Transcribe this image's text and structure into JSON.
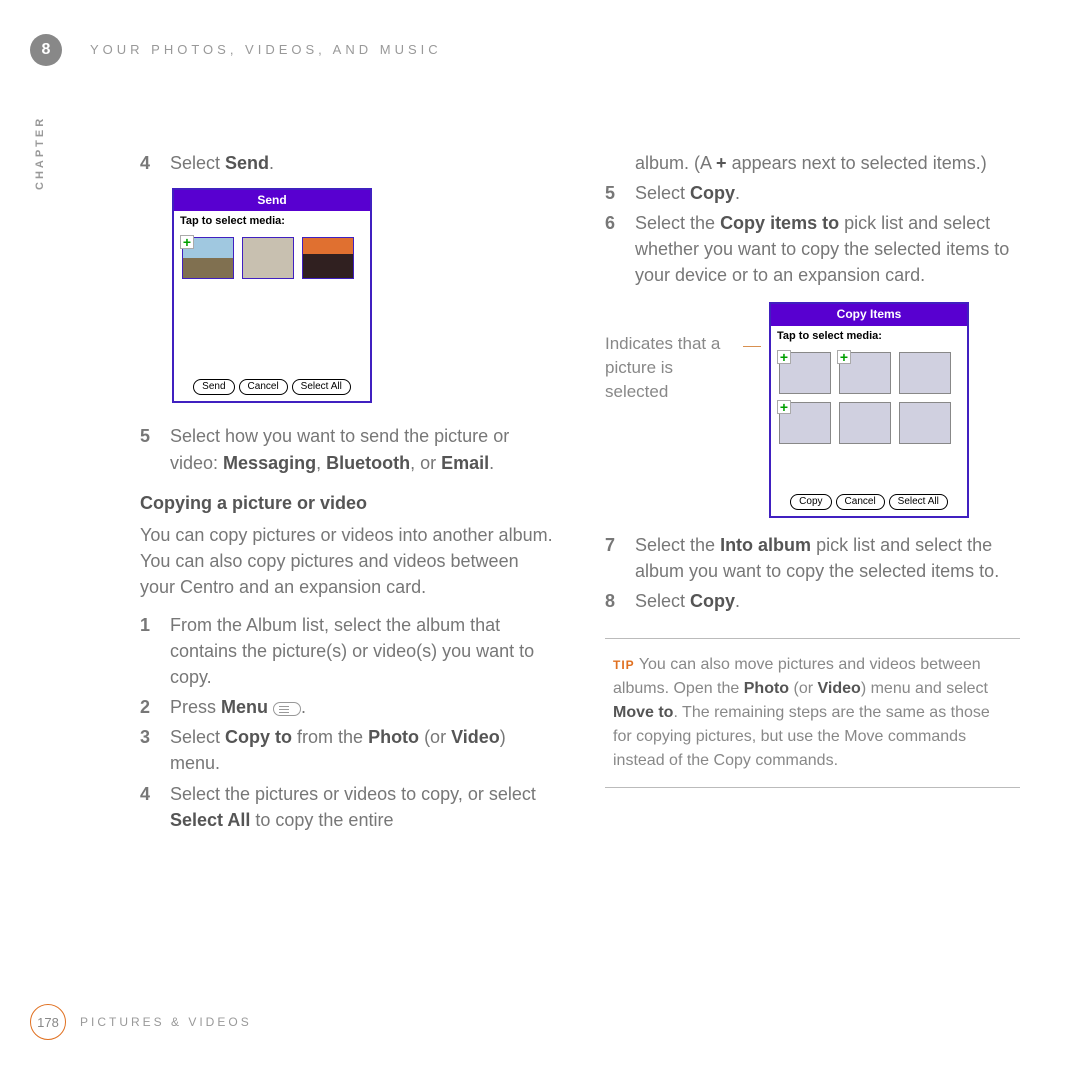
{
  "header": {
    "chapter_num": "8",
    "chapter_title": "YOUR PHOTOS, VIDEOS, AND MUSIC",
    "side_label": "CHAPTER"
  },
  "left": {
    "s4_num": "4",
    "s4_a": "Select ",
    "s4_b": "Send",
    "s4_c": ".",
    "send_title": "Send",
    "send_sub": "Tap to select media:",
    "btn_send": "Send",
    "btn_cancel": "Cancel",
    "btn_selectall": "Select All",
    "s5_num": "5",
    "s5_a": "Select how you want to send the picture or video: ",
    "s5_b": "Messaging",
    "s5_c": ", ",
    "s5_d": "Bluetooth",
    "s5_e": ", or ",
    "s5_f": "Email",
    "s5_g": ".",
    "section": "Copying a picture or video",
    "intro": "You can copy pictures or videos into another album. You can also copy pictures and videos between your Centro and an expansion card.",
    "c1_num": "1",
    "c1": "From the Album list, select the album that contains the picture(s) or video(s) you want to copy.",
    "c2_num": "2",
    "c2_a": "Press ",
    "c2_b": "Menu",
    "c2_c": " ",
    "c2_d": ".",
    "c3_num": "3",
    "c3_a": "Select ",
    "c3_b": "Copy to",
    "c3_c": " from the ",
    "c3_d": "Photo",
    "c3_e": " (or ",
    "c3_f": "Video",
    "c3_g": ") menu.",
    "c4_num": "4",
    "c4_a": "Select the pictures or videos to copy, or select ",
    "c4_b": "Select All",
    "c4_c": " to copy the entire"
  },
  "right": {
    "r_cont_a": "album. (A ",
    "r_cont_b": "+",
    "r_cont_c": " appears next to selected items.)",
    "r5_num": "5",
    "r5_a": "Select ",
    "r5_b": "Copy",
    "r5_c": ".",
    "r6_num": "6",
    "r6_a": "Select the ",
    "r6_b": "Copy items to",
    "r6_c": " pick list and select whether you want to copy the selected items to your device or to an expansion card.",
    "callout": "Indicates that a picture is selected",
    "copy_title": "Copy Items",
    "copy_sub": "Tap to select media:",
    "btn_copy": "Copy",
    "btn_cancel2": "Cancel",
    "btn_selectall2": "Select All",
    "r7_num": "7",
    "r7_a": "Select the ",
    "r7_b": "Into album",
    "r7_c": " pick list and select the album you want to copy the selected items to.",
    "r8_num": "8",
    "r8_a": "Select ",
    "r8_b": "Copy",
    "r8_c": ".",
    "tip_label": "TIP",
    "tip_a": " You can also move pictures and videos between albums. Open the ",
    "tip_b": "Photo",
    "tip_c": " (or ",
    "tip_d": "Video",
    "tip_e": ") menu and select ",
    "tip_f": "Move to",
    "tip_g": ". The remaining steps are the same as those for copying pictures, but use the Move commands instead of the Copy commands."
  },
  "footer": {
    "page": "178",
    "section": "PICTURES & VIDEOS"
  }
}
